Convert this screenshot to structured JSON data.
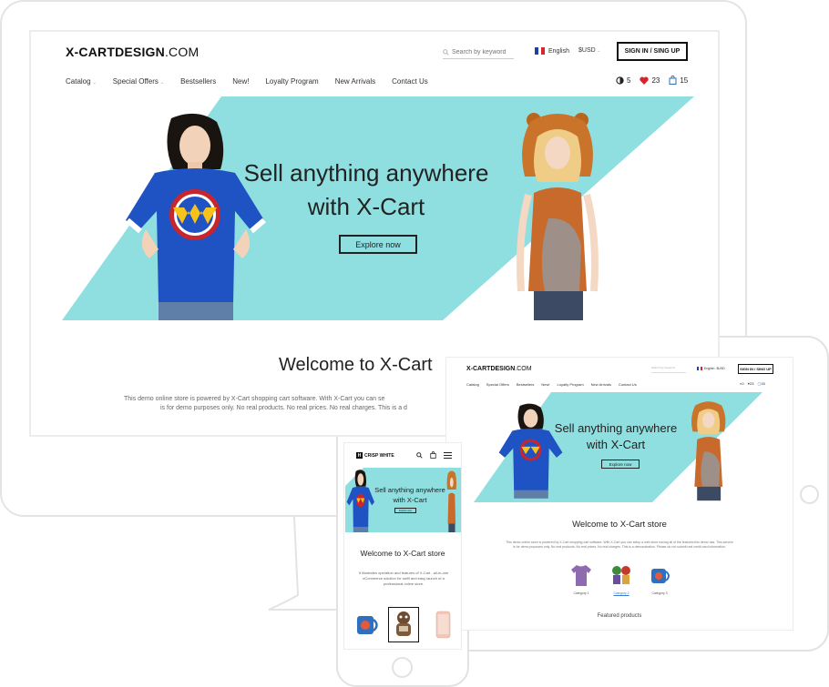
{
  "desktop": {
    "logo_bold": "X-CARTDESIGN",
    "logo_tld": ".COM",
    "search_placeholder": "Search by keyword",
    "language": "English",
    "currency": "$USD",
    "signin_label": "SIGN IN / SING UP",
    "nav": [
      {
        "label": "Catalog",
        "has_dropdown": true
      },
      {
        "label": "Special Offers",
        "has_dropdown": true
      },
      {
        "label": "Bestsellers",
        "has_dropdown": false
      },
      {
        "label": "New!",
        "has_dropdown": false
      },
      {
        "label": "Loyalty Program",
        "has_dropdown": false
      },
      {
        "label": "New Arrivals",
        "has_dropdown": false
      },
      {
        "label": "Contact Us",
        "has_dropdown": false
      }
    ],
    "counters": {
      "compare": "5",
      "wishlist": "23",
      "cart": "15"
    },
    "banner": {
      "headline_line1": "Sell anything anywhere",
      "headline_line2": "with X-Cart",
      "button": "Explore now"
    },
    "welcome_title": "Welcome to X-Cart",
    "description_line1": "This demo online store is powered by X-Cart shopping cart software. With X-Cart you can se",
    "description_line2": "is for demo purposes only. No real products. No real prices. No real charges. This is a d"
  },
  "tablet": {
    "logo_bold": "X-CARTDESIGN",
    "logo_tld": ".COM",
    "search_placeholder": "Search by keyword",
    "language": "English",
    "currency": "$USD",
    "signin_label": "SIGN IN / SING UP",
    "nav": [
      "Catalog",
      "Special Offers",
      "Bestsellers",
      "New!",
      "Loyalty Program",
      "New Arrivals",
      "Contact Us"
    ],
    "counters": {
      "compare": "0",
      "wishlist": "23",
      "cart": "15"
    },
    "banner": {
      "headline_line1": "Sell anything anywhere",
      "headline_line2": "with X-Cart",
      "button": "Explore now"
    },
    "welcome_title": "Welcome to X-Cart store",
    "description_line1": "This demo online store is powered by X-Cart shopping cart software. With X-Cart you can setup a web store having all of the features this demo has. This service",
    "description_line2": "is for demo purposes only. No real products. No real prices. No real charges. This is a demonstration. Please do not submit real credit card information.",
    "categories": [
      {
        "label": "Category 1",
        "active": false
      },
      {
        "label": "Category 2",
        "active": true
      },
      {
        "label": "Category 3",
        "active": false
      }
    ],
    "featured_title": "Featured products"
  },
  "phone": {
    "logo_letter": "H",
    "logo_text": "CRISP WHITE",
    "banner": {
      "headline_line1": "Sell anything anywhere",
      "headline_line2": "with X-Cart",
      "button": "Explore now"
    },
    "welcome_title": "Welcome to X-Cart store",
    "description": "It illustrates operation and features of X-Cart - all-in-one eCommerce solution for swift and easy launch of a professional online store."
  },
  "colors": {
    "banner_teal": "#8fdfe0",
    "heart": "#d8232a",
    "link_blue": "#3a7bd5",
    "flag_blue": "#1f3fa3",
    "flag_red": "#d6272e"
  }
}
